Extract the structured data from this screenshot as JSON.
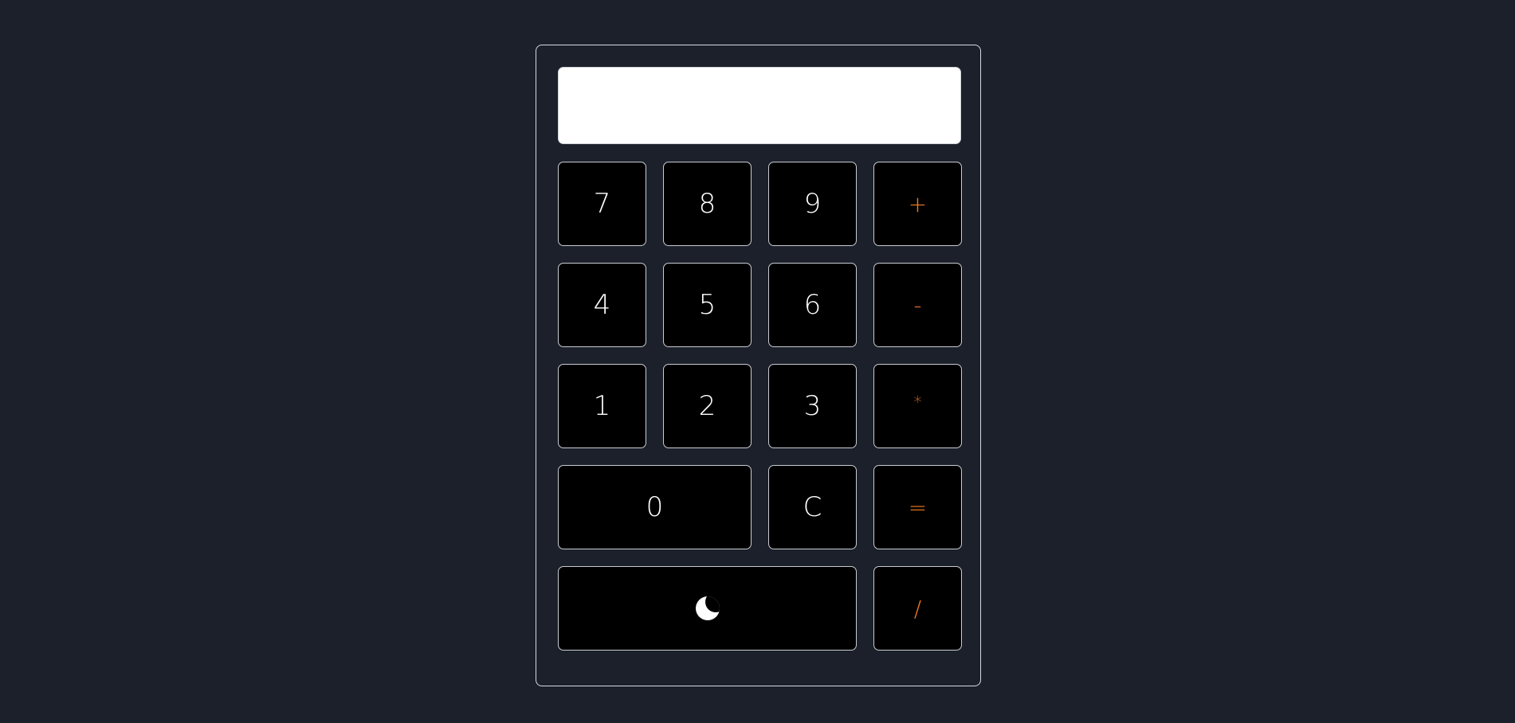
{
  "display": {
    "value": ""
  },
  "keys": {
    "seven": "7",
    "eight": "8",
    "nine": "9",
    "plus": "+",
    "four": "4",
    "five": "5",
    "six": "6",
    "minus": "-",
    "one": "1",
    "two": "2",
    "three": "3",
    "multiply": "*",
    "zero": "0",
    "clear": "C",
    "equals": "=",
    "divide": "/"
  },
  "theme_toggle": {
    "icon": "moon-icon"
  },
  "colors": {
    "page_background": "#1b202b",
    "key_background": "#000000",
    "key_text": "#ffffff",
    "operator_text": "#f47b20",
    "display_background": "#ffffff"
  }
}
